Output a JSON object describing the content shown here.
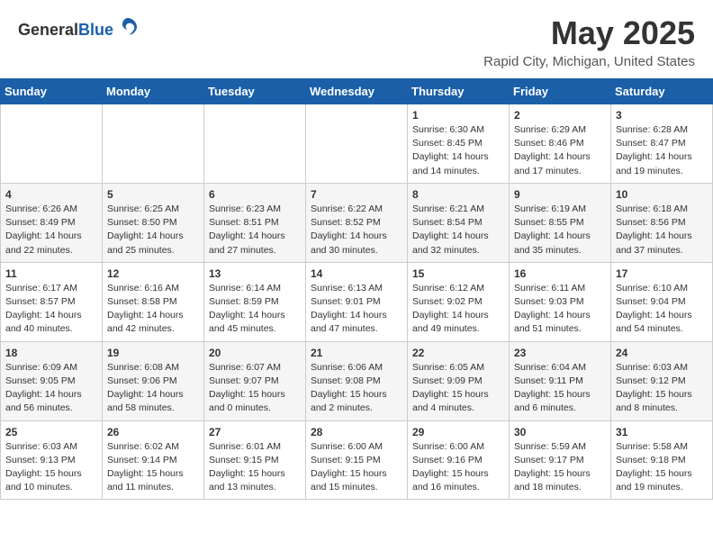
{
  "header": {
    "logo_general": "General",
    "logo_blue": "Blue",
    "month_title": "May 2025",
    "location": "Rapid City, Michigan, United States"
  },
  "weekdays": [
    "Sunday",
    "Monday",
    "Tuesday",
    "Wednesday",
    "Thursday",
    "Friday",
    "Saturday"
  ],
  "weeks": [
    [
      {
        "day": "",
        "info": ""
      },
      {
        "day": "",
        "info": ""
      },
      {
        "day": "",
        "info": ""
      },
      {
        "day": "",
        "info": ""
      },
      {
        "day": "1",
        "info": "Sunrise: 6:30 AM\nSunset: 8:45 PM\nDaylight: 14 hours\nand 14 minutes."
      },
      {
        "day": "2",
        "info": "Sunrise: 6:29 AM\nSunset: 8:46 PM\nDaylight: 14 hours\nand 17 minutes."
      },
      {
        "day": "3",
        "info": "Sunrise: 6:28 AM\nSunset: 8:47 PM\nDaylight: 14 hours\nand 19 minutes."
      }
    ],
    [
      {
        "day": "4",
        "info": "Sunrise: 6:26 AM\nSunset: 8:49 PM\nDaylight: 14 hours\nand 22 minutes."
      },
      {
        "day": "5",
        "info": "Sunrise: 6:25 AM\nSunset: 8:50 PM\nDaylight: 14 hours\nand 25 minutes."
      },
      {
        "day": "6",
        "info": "Sunrise: 6:23 AM\nSunset: 8:51 PM\nDaylight: 14 hours\nand 27 minutes."
      },
      {
        "day": "7",
        "info": "Sunrise: 6:22 AM\nSunset: 8:52 PM\nDaylight: 14 hours\nand 30 minutes."
      },
      {
        "day": "8",
        "info": "Sunrise: 6:21 AM\nSunset: 8:54 PM\nDaylight: 14 hours\nand 32 minutes."
      },
      {
        "day": "9",
        "info": "Sunrise: 6:19 AM\nSunset: 8:55 PM\nDaylight: 14 hours\nand 35 minutes."
      },
      {
        "day": "10",
        "info": "Sunrise: 6:18 AM\nSunset: 8:56 PM\nDaylight: 14 hours\nand 37 minutes."
      }
    ],
    [
      {
        "day": "11",
        "info": "Sunrise: 6:17 AM\nSunset: 8:57 PM\nDaylight: 14 hours\nand 40 minutes."
      },
      {
        "day": "12",
        "info": "Sunrise: 6:16 AM\nSunset: 8:58 PM\nDaylight: 14 hours\nand 42 minutes."
      },
      {
        "day": "13",
        "info": "Sunrise: 6:14 AM\nSunset: 8:59 PM\nDaylight: 14 hours\nand 45 minutes."
      },
      {
        "day": "14",
        "info": "Sunrise: 6:13 AM\nSunset: 9:01 PM\nDaylight: 14 hours\nand 47 minutes."
      },
      {
        "day": "15",
        "info": "Sunrise: 6:12 AM\nSunset: 9:02 PM\nDaylight: 14 hours\nand 49 minutes."
      },
      {
        "day": "16",
        "info": "Sunrise: 6:11 AM\nSunset: 9:03 PM\nDaylight: 14 hours\nand 51 minutes."
      },
      {
        "day": "17",
        "info": "Sunrise: 6:10 AM\nSunset: 9:04 PM\nDaylight: 14 hours\nand 54 minutes."
      }
    ],
    [
      {
        "day": "18",
        "info": "Sunrise: 6:09 AM\nSunset: 9:05 PM\nDaylight: 14 hours\nand 56 minutes."
      },
      {
        "day": "19",
        "info": "Sunrise: 6:08 AM\nSunset: 9:06 PM\nDaylight: 14 hours\nand 58 minutes."
      },
      {
        "day": "20",
        "info": "Sunrise: 6:07 AM\nSunset: 9:07 PM\nDaylight: 15 hours\nand 0 minutes."
      },
      {
        "day": "21",
        "info": "Sunrise: 6:06 AM\nSunset: 9:08 PM\nDaylight: 15 hours\nand 2 minutes."
      },
      {
        "day": "22",
        "info": "Sunrise: 6:05 AM\nSunset: 9:09 PM\nDaylight: 15 hours\nand 4 minutes."
      },
      {
        "day": "23",
        "info": "Sunrise: 6:04 AM\nSunset: 9:11 PM\nDaylight: 15 hours\nand 6 minutes."
      },
      {
        "day": "24",
        "info": "Sunrise: 6:03 AM\nSunset: 9:12 PM\nDaylight: 15 hours\nand 8 minutes."
      }
    ],
    [
      {
        "day": "25",
        "info": "Sunrise: 6:03 AM\nSunset: 9:13 PM\nDaylight: 15 hours\nand 10 minutes."
      },
      {
        "day": "26",
        "info": "Sunrise: 6:02 AM\nSunset: 9:14 PM\nDaylight: 15 hours\nand 11 minutes."
      },
      {
        "day": "27",
        "info": "Sunrise: 6:01 AM\nSunset: 9:15 PM\nDaylight: 15 hours\nand 13 minutes."
      },
      {
        "day": "28",
        "info": "Sunrise: 6:00 AM\nSunset: 9:15 PM\nDaylight: 15 hours\nand 15 minutes."
      },
      {
        "day": "29",
        "info": "Sunrise: 6:00 AM\nSunset: 9:16 PM\nDaylight: 15 hours\nand 16 minutes."
      },
      {
        "day": "30",
        "info": "Sunrise: 5:59 AM\nSunset: 9:17 PM\nDaylight: 15 hours\nand 18 minutes."
      },
      {
        "day": "31",
        "info": "Sunrise: 5:58 AM\nSunset: 9:18 PM\nDaylight: 15 hours\nand 19 minutes."
      }
    ]
  ]
}
